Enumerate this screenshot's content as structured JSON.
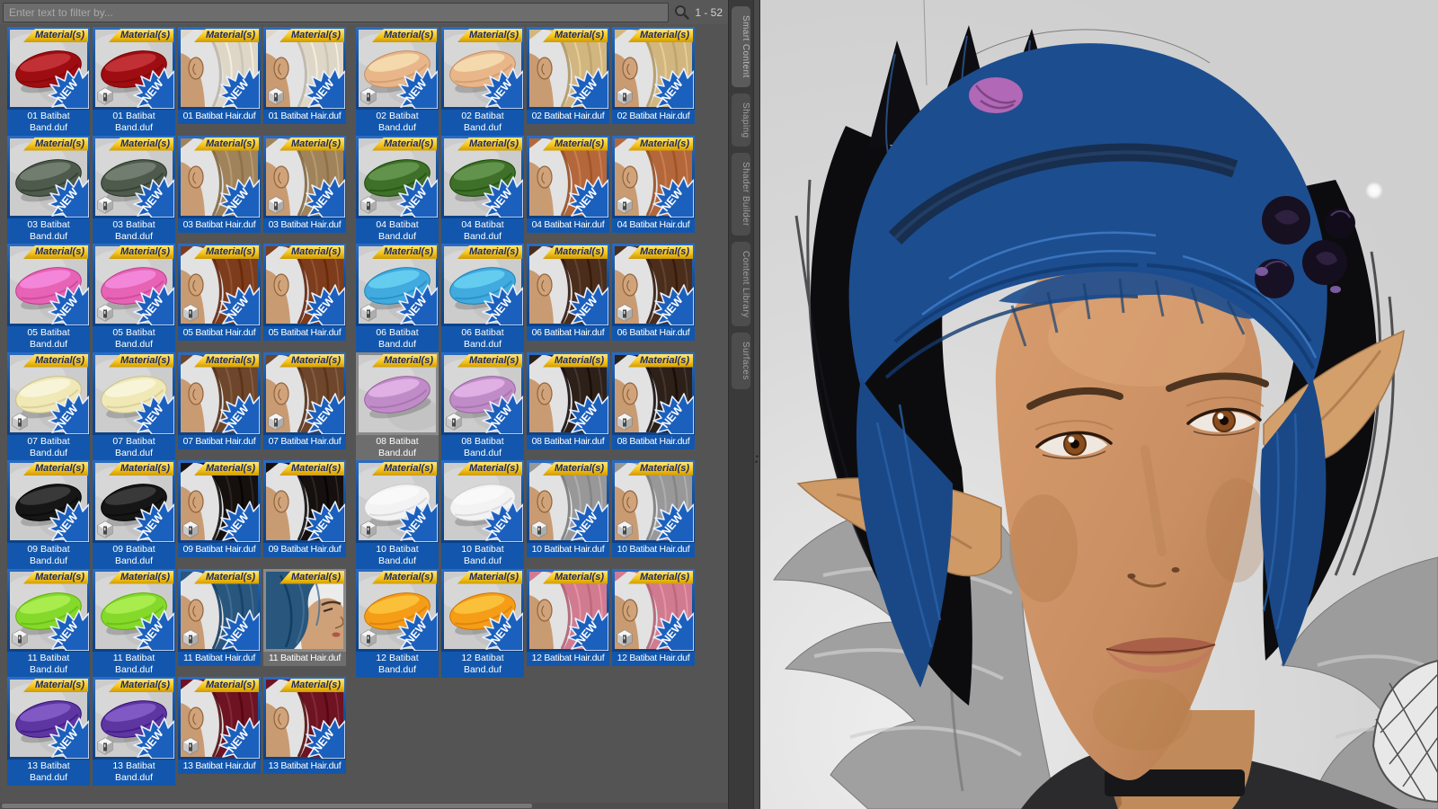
{
  "filter_bar": {
    "placeholder": "Enter text to filter by...",
    "count": "1 - 52",
    "search_icon": "magnifier-icon"
  },
  "tabs": [
    {
      "label": "Smart Content",
      "active": true
    },
    {
      "label": "Shaping",
      "active": false
    },
    {
      "label": "Shader Builder",
      "active": false
    },
    {
      "label": "Content Library",
      "active": false
    },
    {
      "label": "Surfaces",
      "active": false
    }
  ],
  "badges": {
    "material_banner": "Material(s)",
    "new_ribbon": "NEW"
  },
  "colors": {
    "tile_blue": "#1257ad",
    "banner_gold": "#f6c51d",
    "read_gray": "#6e6e6e",
    "panel_gray": "#545454",
    "band_thumb_bg": "#cccccc",
    "hair_thumb_bg": "#e2e2e2",
    "thumb_skin": "#c99b72",
    "viewport_bg": "#d3d3d3",
    "character_hair_blue": "#1c4d8f",
    "character_skin": "#c98f63",
    "scrunchie_pink": "#b168b6",
    "flower_dark": "#161021"
  },
  "groups": [
    {
      "id": "01",
      "band_label": "01 Batibat Band.duf",
      "hair_label": "01 Batibat Hair.duf",
      "band_color": "#9e0d12",
      "hair_color": "#ded7c8",
      "items": [
        {
          "kind": "band",
          "cube": false,
          "state": "new"
        },
        {
          "kind": "band",
          "cube": true,
          "state": "new"
        },
        {
          "kind": "hair",
          "cube": false,
          "state": "new"
        },
        {
          "kind": "hair",
          "cube": true,
          "state": "new"
        }
      ]
    },
    {
      "id": "02",
      "band_label": "02 Batibat Band.duf",
      "hair_label": "02 Batibat Hair.duf",
      "band_color": "#e9b68a",
      "hair_color": "#d2b67f",
      "items": [
        {
          "kind": "band",
          "cube": true,
          "state": "new"
        },
        {
          "kind": "band",
          "cube": false,
          "state": "new"
        },
        {
          "kind": "hair",
          "cube": false,
          "state": "new"
        },
        {
          "kind": "hair",
          "cube": true,
          "state": "new"
        }
      ]
    },
    {
      "id": "03",
      "band_label": "03 Batibat Band.duf",
      "hair_label": "03 Batibat Hair.duf",
      "band_color": "#4d5a4c",
      "hair_color": "#a0835a",
      "items": [
        {
          "kind": "band",
          "cube": false,
          "state": "new"
        },
        {
          "kind": "band",
          "cube": true,
          "state": "new"
        },
        {
          "kind": "hair",
          "cube": false,
          "state": "new"
        },
        {
          "kind": "hair",
          "cube": true,
          "state": "new"
        }
      ]
    },
    {
      "id": "04",
      "band_label": "04 Batibat Band.duf",
      "hair_label": "04 Batibat Hair.duf",
      "band_color": "#3f7029",
      "hair_color": "#b4673a",
      "items": [
        {
          "kind": "band",
          "cube": true,
          "state": "new"
        },
        {
          "kind": "band",
          "cube": false,
          "state": "new"
        },
        {
          "kind": "hair",
          "cube": false,
          "state": "new"
        },
        {
          "kind": "hair",
          "cube": true,
          "state": "new"
        }
      ]
    },
    {
      "id": "05",
      "band_label": "05 Batibat Band.duf",
      "hair_label": "05 Batibat Hair.duf",
      "band_color": "#e763b5",
      "hair_color": "#7d3c1b",
      "items": [
        {
          "kind": "band",
          "cube": false,
          "state": "new"
        },
        {
          "kind": "band",
          "cube": true,
          "state": "new"
        },
        {
          "kind": "hair",
          "cube": true,
          "state": "new"
        },
        {
          "kind": "hair",
          "cube": false,
          "state": "new"
        }
      ]
    },
    {
      "id": "06",
      "band_label": "06 Batibat Band.duf",
      "hair_label": "06 Batibat Hair.duf",
      "band_color": "#41aadf",
      "hair_color": "#4a2d1a",
      "items": [
        {
          "kind": "band",
          "cube": true,
          "state": "new"
        },
        {
          "kind": "band",
          "cube": false,
          "state": "new"
        },
        {
          "kind": "hair",
          "cube": false,
          "state": "new"
        },
        {
          "kind": "hair",
          "cube": true,
          "state": "new"
        }
      ]
    },
    {
      "id": "07",
      "band_label": "07 Batibat Band.duf",
      "hair_label": "07 Batibat Hair.duf",
      "band_color": "#f0e8b5",
      "hair_color": "#6d462b",
      "items": [
        {
          "kind": "band",
          "cube": true,
          "state": "new"
        },
        {
          "kind": "band",
          "cube": false,
          "state": "new"
        },
        {
          "kind": "hair",
          "cube": false,
          "state": "new"
        },
        {
          "kind": "hair",
          "cube": true,
          "state": "new"
        }
      ]
    },
    {
      "id": "08",
      "band_label": "08 Batibat Band.duf",
      "hair_label": "08 Batibat Hair.duf",
      "band_color": "#c08cc8",
      "hair_color": "#2c2018",
      "items": [
        {
          "kind": "band",
          "cube": false,
          "state": "read"
        },
        {
          "kind": "band",
          "cube": true,
          "state": "new"
        },
        {
          "kind": "hair",
          "cube": false,
          "state": "new"
        },
        {
          "kind": "hair",
          "cube": true,
          "state": "new"
        }
      ]
    },
    {
      "id": "09",
      "band_label": "09 Batibat Band.duf",
      "hair_label": "09 Batibat Hair.duf",
      "band_color": "#161616",
      "hair_color": "#15100d",
      "items": [
        {
          "kind": "band",
          "cube": false,
          "state": "new"
        },
        {
          "kind": "band",
          "cube": true,
          "state": "new"
        },
        {
          "kind": "hair",
          "cube": true,
          "state": "new"
        },
        {
          "kind": "hair",
          "cube": false,
          "state": "new"
        }
      ]
    },
    {
      "id": "10",
      "band_label": "10 Batibat Band.duf",
      "hair_label": "10 Batibat Hair.duf",
      "band_color": "#f3f3f3",
      "hair_color": "#989898",
      "items": [
        {
          "kind": "band",
          "cube": true,
          "state": "new"
        },
        {
          "kind": "band",
          "cube": false,
          "state": "new"
        },
        {
          "kind": "hair",
          "cube": true,
          "state": "new"
        },
        {
          "kind": "hair",
          "cube": true,
          "state": "new"
        }
      ]
    },
    {
      "id": "11",
      "band_label": "11 Batibat Band.duf",
      "hair_label": "11 Batibat Hair.duf",
      "band_color": "#85d92b",
      "hair_color": "#29567c",
      "items": [
        {
          "kind": "band",
          "cube": true,
          "state": "new"
        },
        {
          "kind": "band",
          "cube": false,
          "state": "new"
        },
        {
          "kind": "hair",
          "cube": true,
          "state": "new"
        },
        {
          "kind": "hair",
          "cube": false,
          "state": "read",
          "variant": "profile"
        }
      ]
    },
    {
      "id": "12",
      "band_label": "12 Batibat Band.duf",
      "hair_label": "12 Batibat Hair.duf",
      "band_color": "#f59d17",
      "hair_color": "#d17b90",
      "items": [
        {
          "kind": "band",
          "cube": true,
          "state": "new"
        },
        {
          "kind": "band",
          "cube": false,
          "state": "new"
        },
        {
          "kind": "hair",
          "cube": false,
          "state": "new"
        },
        {
          "kind": "hair",
          "cube": true,
          "state": "new"
        }
      ]
    },
    {
      "id": "13",
      "band_label": "13 Batibat Band.duf",
      "hair_label": "13 Batibat Hair.duf",
      "band_color": "#5e36a2",
      "hair_color": "#6d1322",
      "items": [
        {
          "kind": "band",
          "cube": false,
          "state": "new"
        },
        {
          "kind": "band",
          "cube": true,
          "state": "new"
        },
        {
          "kind": "hair",
          "cube": true,
          "state": "new"
        },
        {
          "kind": "hair",
          "cube": false,
          "state": "new"
        }
      ]
    }
  ]
}
